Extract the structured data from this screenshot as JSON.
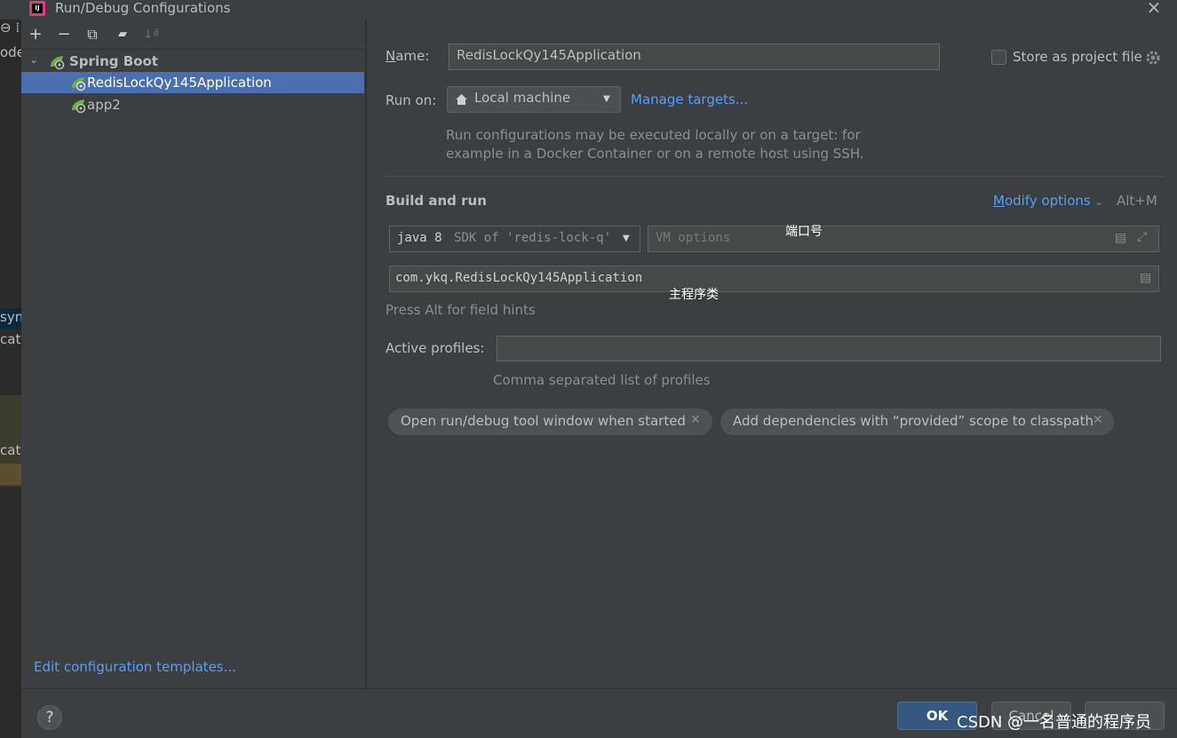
{
  "window": {
    "title": "Run/Debug Configurations",
    "close_glyph": "×",
    "app_icon": "intellij-icon"
  },
  "background_ide": {
    "items": [
      "ode",
      "syn",
      "cati",
      "cati"
    ]
  },
  "toolbar": {
    "add": "+",
    "remove": "−",
    "copy": "⧉",
    "folder": "▰",
    "sort": "↓ª"
  },
  "tree": {
    "group_label": "Spring Boot",
    "items": [
      {
        "label": "RedisLockQy145Application",
        "selected": true
      },
      {
        "label": "app2",
        "selected": false
      }
    ]
  },
  "left_footer": {
    "edit_templates": "Edit configuration templates..."
  },
  "form": {
    "name_label": "Name:",
    "name_value": "RedisLockQy145Application",
    "store_label": "Store as project file",
    "store_checked": false,
    "run_on_label": "Run on:",
    "run_on_value": "Local machine",
    "manage_targets": "Manage targets...",
    "run_on_hint_line1": "Run configurations may be executed locally or on a target: for",
    "run_on_hint_line2": "example in a Docker Container or on a remote host using SSH.",
    "build_and_run": "Build and run",
    "modify_options": "Modify options",
    "modify_shortcut": "Alt+M",
    "jdk_java": "java 8",
    "jdk_detail": "SDK of 'redis-lock-q'",
    "vm_options_placeholder": "VM options",
    "main_class_value": "com.ykq.RedisLockQy145Application",
    "field_hints": "Press Alt for field hints",
    "active_profiles_label": "Active profiles:",
    "active_profiles_value": "",
    "profiles_hint": "Comma separated list of profiles",
    "chips": [
      "Open run/debug tool window when started",
      "Add dependencies with “provided” scope to classpath"
    ]
  },
  "annotations": {
    "port_note": "端口号",
    "main_class_note": "主程序类"
  },
  "bottom": {
    "help": "?",
    "ok": "OK",
    "cancel": "Cancel"
  },
  "watermark": "CSDN @一名普通的程序员",
  "colors": {
    "background": "#3c3f41",
    "selection": "#4b6eaf",
    "link": "#589df6",
    "field_bg": "#45494a",
    "ok_button": "#365880"
  }
}
